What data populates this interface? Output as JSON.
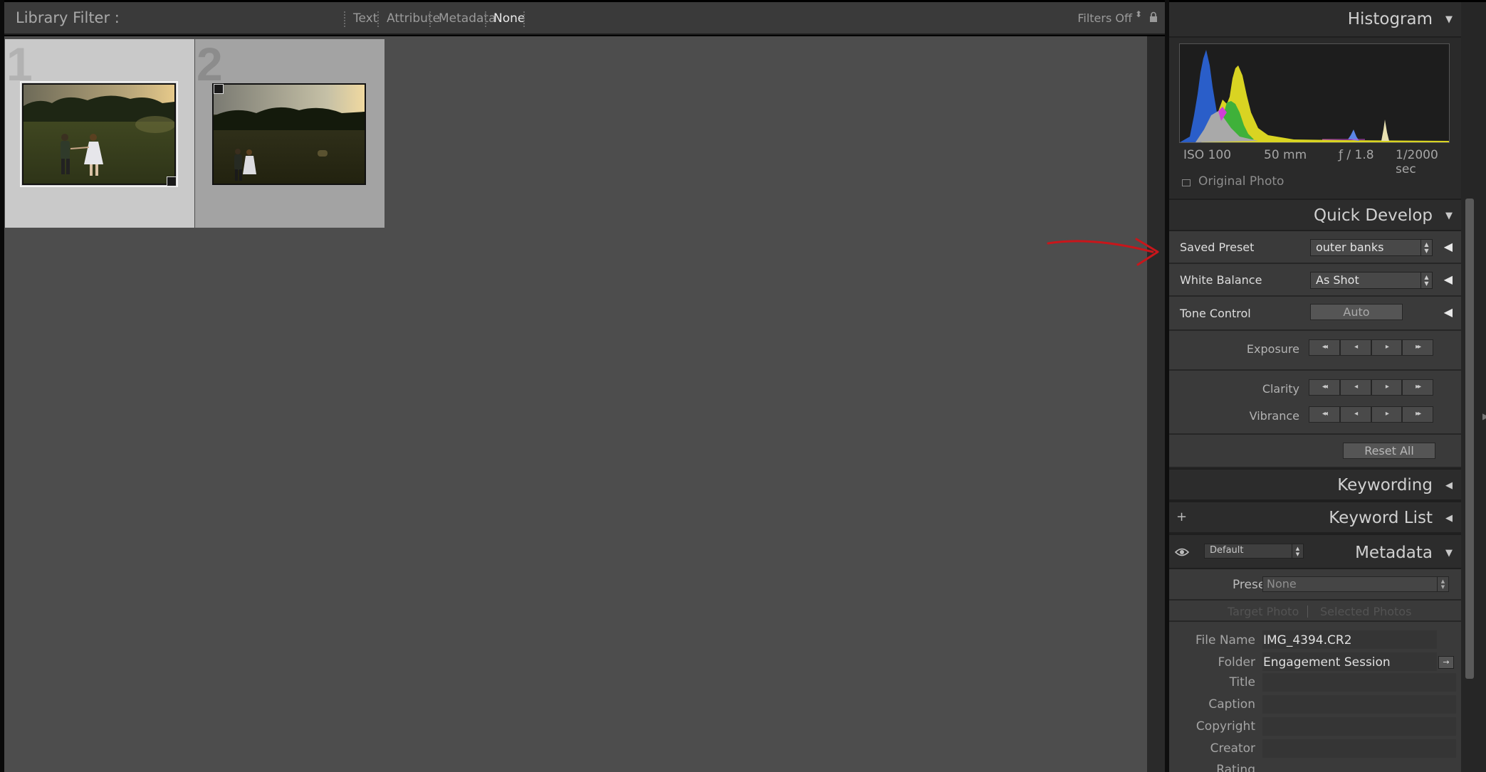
{
  "filter_bar": {
    "title": "Library Filter :",
    "tabs": [
      {
        "label": "Text"
      },
      {
        "label": "Attribute"
      },
      {
        "label": "Metadata"
      },
      {
        "label": "None",
        "active": true
      }
    ],
    "filters_off": "Filters Off",
    "caret": "⬍"
  },
  "grid": {
    "cells": [
      {
        "index": "1",
        "selected": true
      },
      {
        "index": "2",
        "selected": false
      }
    ]
  },
  "histogram": {
    "title": "Histogram",
    "iso": "ISO 100",
    "focal": "50 mm",
    "aperture": "ƒ / 1.8",
    "shutter": "1/2000 sec",
    "original_photo": "Original Photo"
  },
  "quick_develop": {
    "title": "Quick Develop",
    "saved_preset": {
      "label": "Saved Preset",
      "value": "outer banks"
    },
    "white_balance": {
      "label": "White Balance",
      "value": "As Shot"
    },
    "tone_control": {
      "label": "Tone Control",
      "button": "Auto"
    },
    "exposure": "Exposure",
    "clarity": "Clarity",
    "vibrance": "Vibrance",
    "reset_all": "Reset All",
    "stepper_glyphs": [
      "◂◂",
      "◂",
      "▸",
      "▸▸"
    ]
  },
  "keywording": {
    "title": "Keywording"
  },
  "keyword_list": {
    "title": "Keyword List",
    "plus": "+"
  },
  "metadata": {
    "title": "Metadata",
    "preset_select": "Default",
    "preset_label": "Preset",
    "preset_value": "None",
    "target_photo": "Target Photo",
    "selected_photos": "Selected Photos",
    "fields": {
      "file_name": {
        "label": "File Name",
        "value": "IMG_4394.CR2"
      },
      "folder": {
        "label": "Folder",
        "value": "Engagement Session"
      },
      "title": {
        "label": "Title"
      },
      "caption": {
        "label": "Caption"
      },
      "copyright": {
        "label": "Copyright"
      },
      "creator": {
        "label": "Creator"
      },
      "rating": {
        "label": "Rating"
      }
    }
  },
  "colors": {
    "accent_annotation": "#c8161b",
    "panel_bg": "#333333",
    "grid_bg": "#4d4d4d"
  },
  "icons": {
    "section_collapse": "triangle-down-icon",
    "section_expand": "triangle-left-icon",
    "lock": "lock-icon",
    "eye": "eye-icon"
  }
}
